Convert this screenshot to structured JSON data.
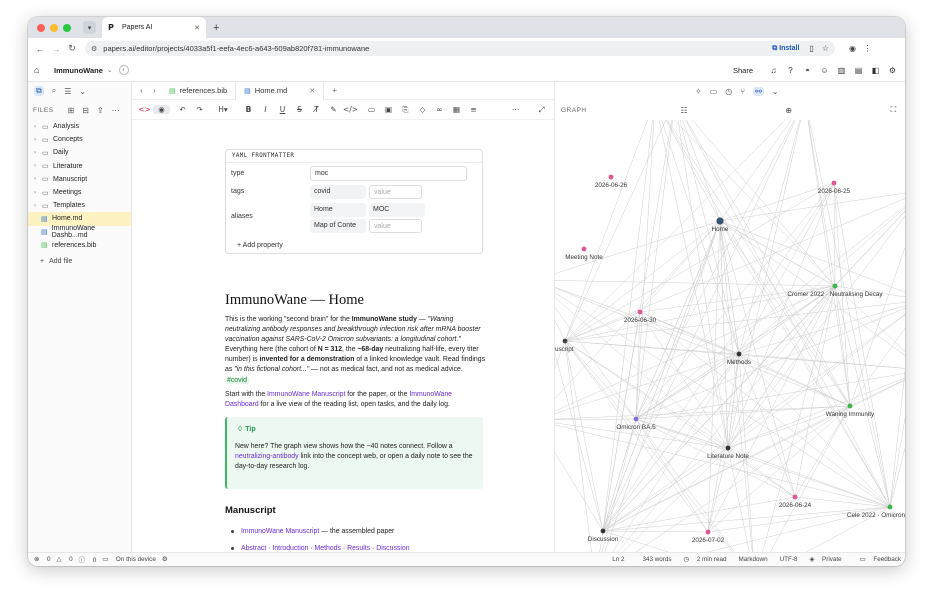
{
  "browser": {
    "tab_title": "Papers AI",
    "url": "papers.ai/editor/projects/4033a5f1-eefa-4ec6-a643-609ab820f781-immunowane",
    "install_label": "Install"
  },
  "app": {
    "project_name": "ImmunoWane",
    "share_label": "Share"
  },
  "sidebar": {
    "files_label": "FILES",
    "folders": [
      "Analysis",
      "Concepts",
      "Daily",
      "Literature",
      "Manuscript",
      "Meetings",
      "Templates"
    ],
    "files": [
      {
        "name": "Home.md",
        "active": true,
        "icon": "markdown-file-icon"
      },
      {
        "name": "ImmunoWane Dashb...md",
        "active": false,
        "icon": "markdown-file-icon"
      },
      {
        "name": "references.bib",
        "active": false,
        "icon": "bib-file-icon"
      }
    ],
    "add_file_label": "Add file"
  },
  "tabs": [
    {
      "label": "references.bib",
      "active": false
    },
    {
      "label": "Home.md",
      "active": true
    }
  ],
  "frontmatter": {
    "header": "YAML FRONTMATTER",
    "type_key": "type",
    "type_value": "moc",
    "tags_key": "tags",
    "tags_value": "covid",
    "tags_placeholder": "value",
    "aliases_key": "aliases",
    "aliases": [
      "Home",
      "MOC",
      "Map of Conte"
    ],
    "aliases_placeholder": "value",
    "add_property_label": "Add property"
  },
  "doc": {
    "title": "ImmunoWane — Home",
    "intro": {
      "t1": "This is the working \"second brain\" for the ",
      "b1": "ImmunoWane study",
      "t2": " — ",
      "i1": "\"Waning neutralizing antibody responses and breakthrough infection risk after mRNA booster vaccination against SARS-CoV-2 Omicron subvariants: a longitudinal cohort.\"",
      "t3": " Everything here (the cohort of ",
      "b2": "N = 312",
      "t4": ", the ",
      "b3": "~68-day",
      "t5": " neutralizing half-life, every titer number) is ",
      "b4": "invented for a demonstration",
      "t6": " of a linked knowledge vault. Read findings as ",
      "i2": "\"in this fictional cohort...\"",
      "t7": " — not as medical fact, and not as medical advice. ",
      "tag": "#covid"
    },
    "start": {
      "t1": "Start with the ",
      "l1": "ImmunoWane Manuscript",
      "t2": " for the paper, or the ",
      "l2": "ImmunoWane Dashboard",
      "t3": " for a live view of the reading list, open tasks, and the daily log."
    },
    "tip": {
      "title": "Tip",
      "t1": "New here? The graph view shows how the ~40 notes connect. Follow a ",
      "l1": "neutralizing-antibody",
      "t2": " link into the concept web, or open a daily note to see the day-to-day research log."
    },
    "section": "Manuscript",
    "bullet1_link": "ImmunoWane Manuscript",
    "bullet1_text": " — the assembled paper",
    "bullet2": [
      "Abstract",
      "Introduction",
      "Methods",
      "Results",
      "Discussion"
    ],
    "bullet2_sep": " · "
  },
  "graph": {
    "label": "GRAPH",
    "nodes": [
      {
        "label": "2026-06-26",
        "color": "#e0559a"
      },
      {
        "label": "2026-06-25",
        "color": "#e0559a"
      },
      {
        "label": "Home",
        "color": "#3b5472"
      },
      {
        "label": "Meeting Note",
        "color": "#e0559a"
      },
      {
        "label": "Cromer 2022 · Neutralising Decay",
        "color": "#3cb84a"
      },
      {
        "label": "2026-06-30",
        "color": "#e0559a"
      },
      {
        "label": "uscript",
        "color": "#444444"
      },
      {
        "label": "Methods",
        "color": "#333333"
      },
      {
        "label": "Omicron BA.5",
        "color": "#8b6cd6"
      },
      {
        "label": "Waning Immunity",
        "color": "#3cb84a"
      },
      {
        "label": "Literature Note",
        "color": "#333333"
      },
      {
        "label": "2026-06-24",
        "color": "#e0559a"
      },
      {
        "label": "Cele 2022 · Omicron",
        "color": "#3cb84a"
      },
      {
        "label": "Discussion",
        "color": "#333333"
      },
      {
        "label": "2026-07-02",
        "color": "#e0559a"
      }
    ]
  },
  "status": {
    "errors": "0",
    "warnings": "0",
    "info": "0",
    "location": "On this device",
    "line": "Ln 2",
    "words": "343 words",
    "read": "2 min read",
    "format": "Markdown",
    "encoding": "UTF-8",
    "privacy": "Private",
    "feedback": "Feedback"
  }
}
